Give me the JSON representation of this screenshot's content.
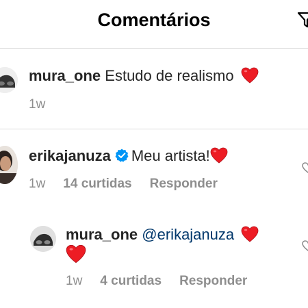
{
  "header": {
    "title": "Comentários",
    "filter_icon": "filter-icon"
  },
  "comments": [
    {
      "username": "mura_one",
      "text": "Estudo  de realismo",
      "emoji": "❤️",
      "time": "1w"
    },
    {
      "username": "erikajanuza",
      "verified": true,
      "text": "Meu artista!",
      "emoji": "❤️",
      "time": "1w",
      "likes": "14 curtidas",
      "reply": "Responder"
    },
    {
      "username": "mura_one",
      "mention": "@erikajanuza",
      "emoji": "❤️",
      "time": "1w",
      "likes": "4 curtidas",
      "reply": "Responder"
    }
  ],
  "colors": {
    "text": "#262626",
    "muted": "#8e8e8e",
    "mention": "#00376b",
    "heart": "#ed1c24",
    "verified": "#0095f6",
    "divider": "#dbdbdb"
  }
}
